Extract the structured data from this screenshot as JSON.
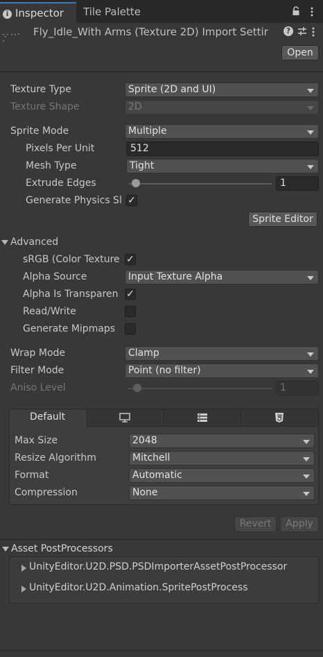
{
  "tabs": [
    {
      "label": "Inspector",
      "active": true
    },
    {
      "label": "Tile Palette",
      "active": false
    }
  ],
  "header": {
    "title": "Fly_Idle_With Arms (Texture 2D) Import Settir",
    "open_label": "Open"
  },
  "texture": {
    "type_label": "Texture Type",
    "type_value": "Sprite (2D and UI)",
    "shape_label": "Texture Shape",
    "shape_value": "2D"
  },
  "sprite": {
    "mode_label": "Sprite Mode",
    "mode_value": "Multiple",
    "ppu_label": "Pixels Per Unit",
    "ppu_value": "512",
    "mesh_label": "Mesh Type",
    "mesh_value": "Tight",
    "extrude_label": "Extrude Edges",
    "extrude_value": "1",
    "physics_label": "Generate Physics Sl",
    "physics_checked": "✓",
    "editor_button": "Sprite Editor"
  },
  "advanced": {
    "title": "Advanced",
    "srgb_label": "sRGB (Color Texture",
    "srgb_checked": "✓",
    "alpha_source_label": "Alpha Source",
    "alpha_source_value": "Input Texture Alpha",
    "alpha_transp_label": "Alpha Is Transparen",
    "alpha_transp_checked": "✓",
    "readwrite_label": "Read/Write",
    "mipmaps_label": "Generate Mipmaps"
  },
  "wrap": {
    "wrap_label": "Wrap Mode",
    "wrap_value": "Clamp",
    "filter_label": "Filter Mode",
    "filter_value": "Point (no filter)",
    "aniso_label": "Aniso Level",
    "aniso_value": "1"
  },
  "platform": {
    "tabs": [
      "Default",
      "monitor-icon",
      "server-icon",
      "html5-icon"
    ],
    "maxsize_label": "Max Size",
    "maxsize_value": "2048",
    "resize_label": "Resize Algorithm",
    "resize_value": "Mitchell",
    "format_label": "Format",
    "format_value": "Automatic",
    "compression_label": "Compression",
    "compression_value": "None"
  },
  "actions": {
    "revert": "Revert",
    "apply": "Apply"
  },
  "postprocessors": {
    "title": "Asset PostProcessors",
    "items": [
      "UnityEditor.U2D.PSD.PSDImporterAssetPostProcessor",
      "UnityEditor.U2D.Animation.SpritePostProcess"
    ]
  },
  "colors": {
    "accent": "#3a79bb",
    "panel": "#383838",
    "tabbar": "#282828"
  }
}
